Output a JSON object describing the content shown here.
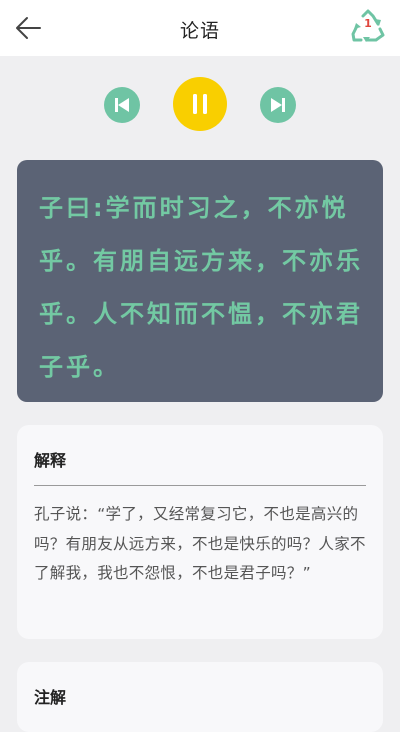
{
  "header": {
    "title": "论语",
    "back_icon": "arrow-left-icon",
    "recycle_icon": "recycle-icon",
    "recycle_count": "1"
  },
  "player": {
    "prev_icon": "rewind-icon",
    "pause_icon": "pause-icon",
    "next_icon": "fast-forward-icon",
    "state": "playing"
  },
  "quote": {
    "text": "子曰:学而时习之，不亦悦乎。有朋自远方来，不亦乐乎。人不知而不愠，不亦君子乎。"
  },
  "explain": {
    "title": "解释",
    "body": "孔子说：“学了，又经常复习它，不也是高兴的吗？有朋友从远方来，不也是快乐的吗？人家不了解我，我也不怨恨，不也是君子吗？”"
  },
  "notes": {
    "title": "注解"
  },
  "colors": {
    "accent_green": "#6fc4a4",
    "accent_yellow": "#f9cf00",
    "quote_bg": "#5b6375",
    "quote_text": "#73c9a3",
    "badge_red": "#e0463d"
  }
}
